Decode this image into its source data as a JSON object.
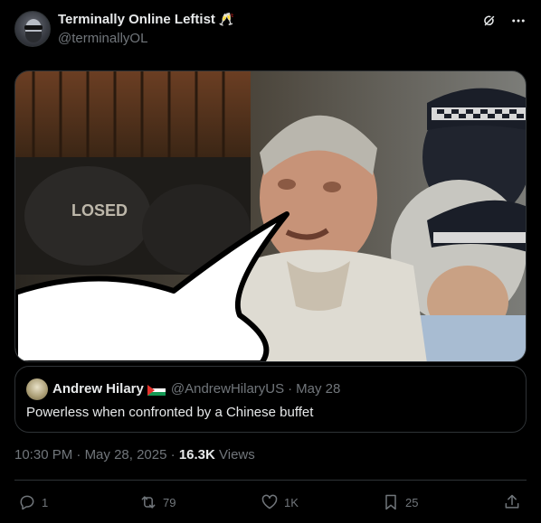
{
  "author": {
    "display_name": "Terminally Online Leftist",
    "emoji": "🥂",
    "handle": "@terminallyOL"
  },
  "header_icons": [
    "grok-icon",
    "more-icon"
  ],
  "media": {
    "visible_sign_text": "LOSED"
  },
  "quoted_post": {
    "display_name": "Andrew Hilary",
    "flag": "palestine-flag",
    "handle": "@AndrewHilaryUS",
    "separator": "·",
    "date": "May 28",
    "text": "Powerless when confronted by a Chinese buffet"
  },
  "meta": {
    "time": "10:30 PM",
    "separator": "·",
    "date": "May 28, 2025",
    "separator2": "·",
    "views_count": "16.3K",
    "views_label": "Views"
  },
  "actions": {
    "replies": "1",
    "reposts": "79",
    "likes": "1K",
    "bookmarks": "25"
  },
  "colors": {
    "background": "#000000",
    "text": "#e7e9ea",
    "secondary": "#71767b",
    "border": "#2f3336"
  }
}
